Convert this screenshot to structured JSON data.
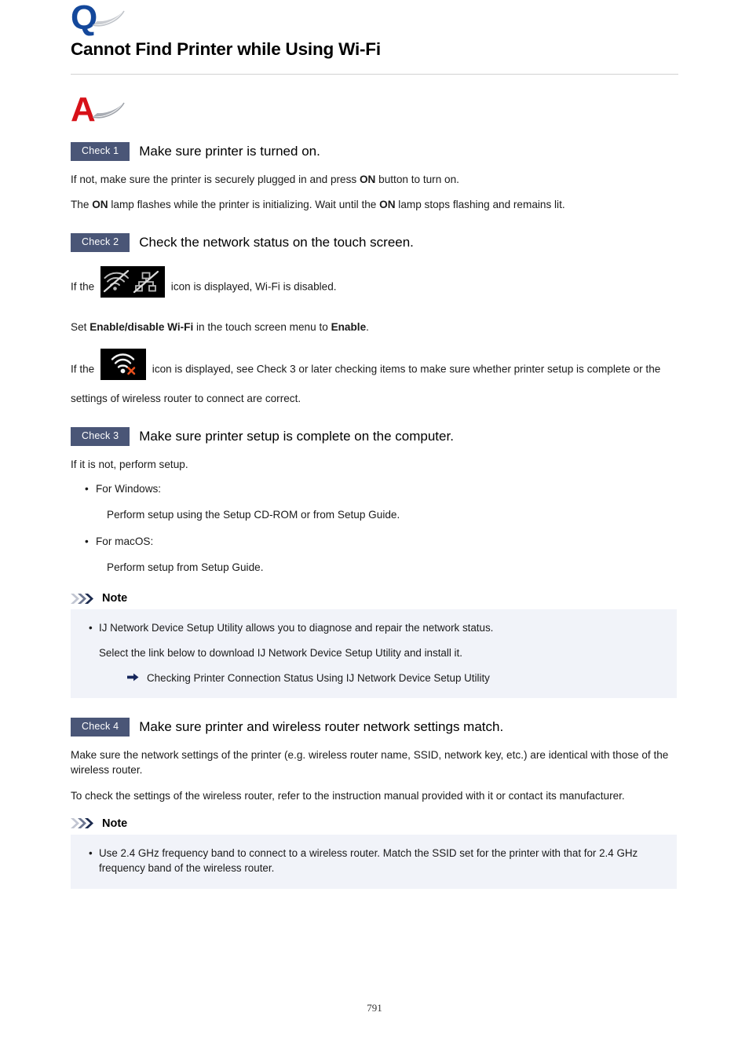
{
  "document": {
    "title": "Cannot Find Printer while Using Wi-Fi",
    "page_number": "791",
    "question_mark_letter": "Q",
    "answer_mark_letter": "A",
    "colors": {
      "question_mark": "#14489b",
      "answer_mark": "#d71118",
      "check_badge": "#4a5677",
      "note_box_background": "#f1f3f9",
      "note_chevron_dark": "#1b2a4e",
      "link_arrow": "#16265c",
      "rule": "#d2d2d2"
    }
  },
  "checks": [
    {
      "badge": "Check 1",
      "title": "Make sure printer is turned on.",
      "paragraph_1_a": "If not, make sure the printer is securely plugged in and press ",
      "paragraph_1_bold": "ON",
      "paragraph_1_b": " button to turn on.",
      "paragraph_2_a": "The ",
      "paragraph_2_bold_1": "ON",
      "paragraph_2_b": " lamp flashes while the printer is initializing. Wait until the ",
      "paragraph_2_bold_2": "ON",
      "paragraph_2_c": " lamp stops flashing and remains lit."
    },
    {
      "badge": "Check 2",
      "title": "Check the network status on the touch screen.",
      "icon_1_name": "wifi-disabled-icon",
      "icon_1_line_prefix": "If the ",
      "icon_1_line_suffix": " icon is displayed, Wi-Fi is disabled.",
      "set_line_a": "Set ",
      "set_line_bold_1": "Enable/disable Wi-Fi",
      "set_line_b": " in the touch screen menu to ",
      "set_line_bold_2": "Enable",
      "set_line_c": ".",
      "icon_2_name": "wifi-error-icon",
      "icon_2_line_prefix": "If the ",
      "icon_2_line_suffix": " icon is displayed, see Check 3 or later checking items to make sure whether printer setup is complete or the settings of wireless router to connect are correct."
    },
    {
      "badge": "Check 3",
      "title": "Make sure printer setup is complete on the computer.",
      "paragraph_1": "If it is not, perform setup.",
      "list": [
        {
          "label": "For Windows:",
          "detail": "Perform setup using the Setup CD-ROM or from Setup Guide."
        },
        {
          "label": "For macOS:",
          "detail": "Perform setup from Setup Guide."
        }
      ],
      "note": {
        "label": "Note",
        "bullet_1": "IJ Network Device Setup Utility allows you to diagnose and repair the network status.",
        "sub_1": "Select the link below to download IJ Network Device Setup Utility and install it.",
        "link_1": "Checking Printer Connection Status Using IJ Network Device Setup Utility"
      }
    },
    {
      "badge": "Check 4",
      "title": "Make sure printer and wireless router network settings match.",
      "paragraph_1": "Make sure the network settings of the printer (e.g. wireless router name, SSID, network key, etc.) are identical with those of the wireless router.",
      "paragraph_2": "To check the settings of the wireless router, refer to the instruction manual provided with it or contact its manufacturer.",
      "note": {
        "label": "Note",
        "bullet_1": "Use 2.4 GHz frequency band to connect to a wireless router. Match the SSID set for the printer with that for 2.4 GHz frequency band of the wireless router."
      }
    }
  ],
  "glyphs": {
    "bullet": "•"
  }
}
